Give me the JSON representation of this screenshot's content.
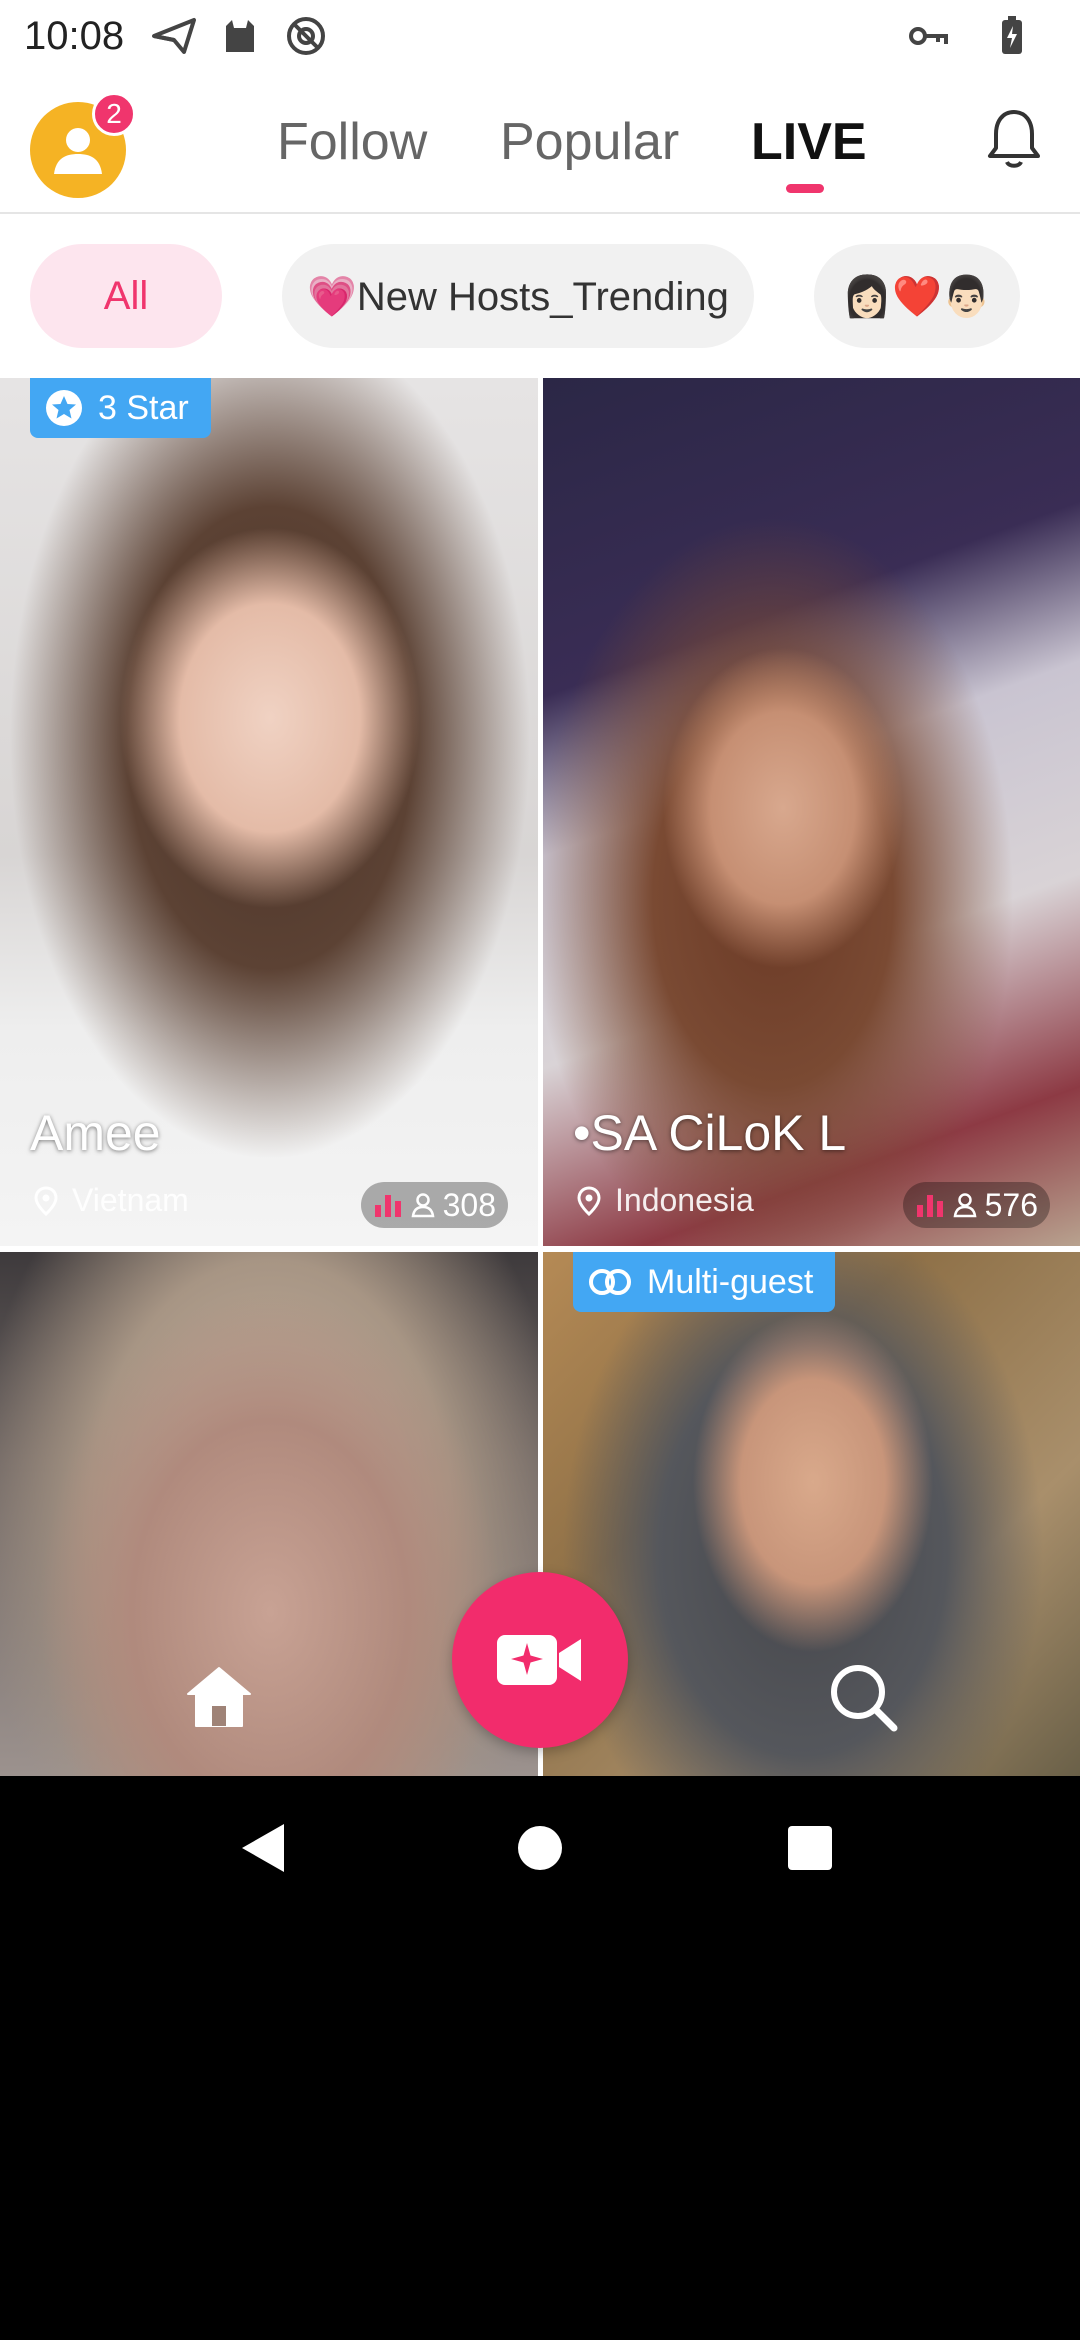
{
  "status_bar": {
    "time": "10:08"
  },
  "header": {
    "notification_count": "2",
    "tabs": [
      {
        "label": "Follow",
        "active": false
      },
      {
        "label": "Popular",
        "active": false
      },
      {
        "label": "LIVE",
        "active": true
      }
    ]
  },
  "filters": [
    {
      "label": "All",
      "active": true
    },
    {
      "label": "💗New Hosts_Trending",
      "active": false
    },
    {
      "label": "👩🏻❤️👨🏻",
      "active": false
    }
  ],
  "streams": [
    {
      "tag": "3 Star",
      "tag_icon": "star-icon",
      "name": "Amee",
      "location": "Vietnam",
      "viewers": "308"
    },
    {
      "tag": "",
      "name": "•SA CiLoK  L",
      "location": "Indonesia",
      "viewers": "576"
    },
    {
      "tag": "",
      "name": "",
      "location": "",
      "viewers": ""
    },
    {
      "tag": "Multi-guest",
      "tag_icon": "link-icon",
      "name": "",
      "location": "",
      "viewers": ""
    }
  ],
  "bottom_bar": {
    "items": [
      "home-icon",
      "go-live-icon",
      "search-icon"
    ]
  },
  "colors": {
    "accent": "#f0356d",
    "tag_blue": "#43a7f3",
    "avatar": "#f5b324"
  }
}
